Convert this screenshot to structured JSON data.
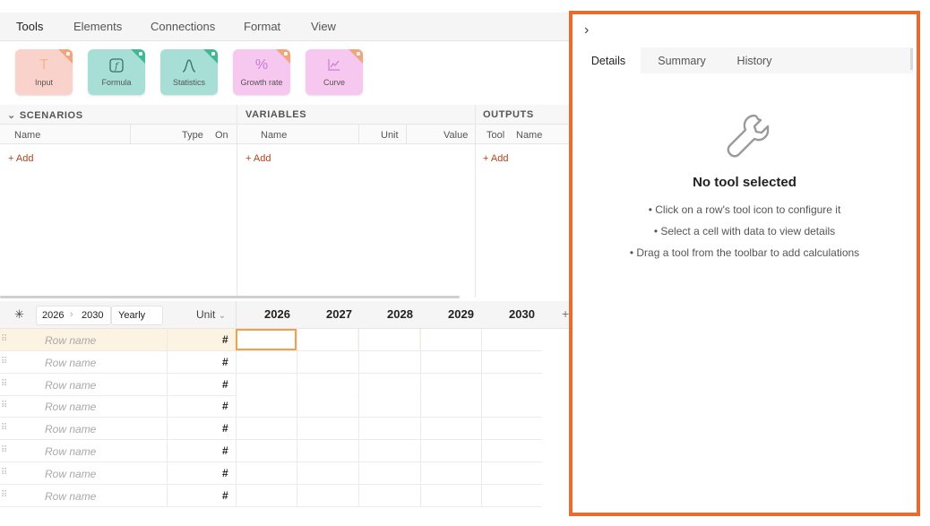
{
  "top_tabs": [
    "Tools",
    "Elements",
    "Connections",
    "Format",
    "View"
  ],
  "toolbar": {
    "tools": [
      {
        "label": "Input",
        "icon": "text-cursor-icon",
        "glyph": "T",
        "bg": "#f9d2cb",
        "accent": "#f2a57b",
        "glyph_color": "#f0b78f"
      },
      {
        "label": "Formula",
        "icon": "function-icon",
        "glyph": "ƒ",
        "bg": "#a7ded6",
        "accent": "#3fb893",
        "glyph_color": "#3b6e66"
      },
      {
        "label": "Statistics",
        "icon": "bell-curve-icon",
        "glyph": "∧",
        "bg": "#a7ded6",
        "accent": "#3fb893",
        "glyph_color": "#3b6e66"
      },
      {
        "label": "Growth rate",
        "icon": "percent-icon",
        "glyph": "%",
        "bg": "#f6c7ef",
        "accent": "#f2a57b",
        "glyph_color": "#c97bd2"
      },
      {
        "label": "Curve",
        "icon": "line-chart-icon",
        "glyph": "⟋",
        "bg": "#f6c7ef",
        "accent": "#f2a57b",
        "glyph_color": "#c97bd2"
      }
    ]
  },
  "scenarios": {
    "title": "SCENARIOS",
    "collapse_glyph": "⌄",
    "columns": [
      "Name",
      "Type",
      "On"
    ],
    "add_label": "+ Add"
  },
  "variables": {
    "title": "VARIABLES",
    "columns": [
      "Name",
      "Unit",
      "Value"
    ],
    "add_label": "+ Add"
  },
  "outputs": {
    "title": "OUTPUTS",
    "columns": [
      "Tool",
      "Name"
    ],
    "add_label": "+ Add"
  },
  "grid": {
    "range_start": "2026",
    "range_arrow": "›",
    "range_end": "2030",
    "frequency": "Yearly",
    "unit_label": "Unit",
    "unit_caret": "⌄",
    "asterisk": "✳",
    "years": [
      "2026",
      "2027",
      "2028",
      "2029",
      "2030"
    ],
    "add_col": "+",
    "rows": [
      {
        "name": "Row name",
        "unit": "#"
      },
      {
        "name": "Row name",
        "unit": "#"
      },
      {
        "name": "Row name",
        "unit": "#"
      },
      {
        "name": "Row name",
        "unit": "#"
      },
      {
        "name": "Row name",
        "unit": "#"
      },
      {
        "name": "Row name",
        "unit": "#"
      },
      {
        "name": "Row name",
        "unit": "#"
      },
      {
        "name": "Row name",
        "unit": "#"
      }
    ],
    "drag_glyph": "⠿"
  },
  "right_panel": {
    "collapse_glyph": "›",
    "tabs": [
      "Details",
      "Summary",
      "History"
    ],
    "empty_title": "No tool selected",
    "bullets": [
      "• Click on a row's tool icon to configure it",
      "• Select a cell with data to view details",
      "• Drag a tool from the toolbar to add calculations"
    ]
  },
  "colors": {
    "accent_orange": "#ee6a2c",
    "add_link": "#b0431b",
    "selected_row": "#fdf3e3"
  }
}
